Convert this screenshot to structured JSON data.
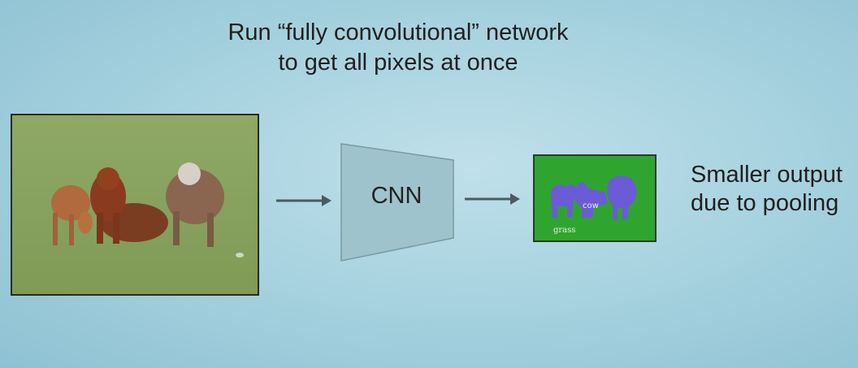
{
  "title": {
    "line1": "Run “fully convolutional” network",
    "line2": "to get all pixels at once"
  },
  "cnn": {
    "label": "CNN"
  },
  "segmentation": {
    "cow_label": "cow",
    "grass_label": "grass"
  },
  "note": {
    "line1": "Smaller output",
    "line2": "due to pooling"
  },
  "colors": {
    "background": "#a9d3e0",
    "cnn_fill": "#9fc3cc",
    "seg_grass": "#2fa52f",
    "seg_cow": "#6b5bd6"
  }
}
